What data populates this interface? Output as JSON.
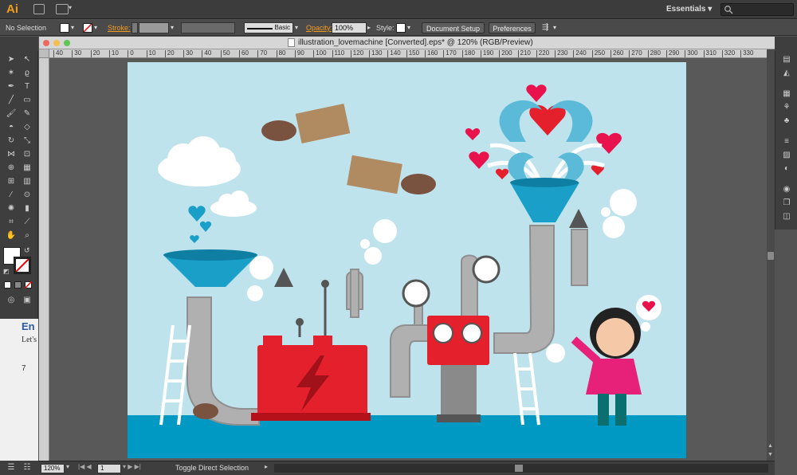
{
  "menubar": {
    "app_logo": "Ai",
    "workspace": "Essentials",
    "workspace_arrow": "▾",
    "search_icon": "magnifier"
  },
  "control": {
    "selection": "No Selection",
    "stroke_label": "Stroke:",
    "brush_label": "Basic",
    "opacity_label": "Opacity:",
    "opacity_value": "100%",
    "style_label": "Style:",
    "doc_setup": "Document Setup",
    "preferences": "Preferences"
  },
  "document": {
    "tab_title": "illustration_lovemachine [Converted].eps* @ 120% (RGB/Preview)"
  },
  "ruler": {
    "ticks": [
      "40",
      "30",
      "20",
      "10",
      "0",
      "10",
      "20",
      "30",
      "40",
      "50",
      "60",
      "70",
      "80",
      "90",
      "100",
      "110",
      "120",
      "130",
      "140",
      "150",
      "160",
      "170",
      "180",
      "190",
      "200",
      "210",
      "220",
      "230",
      "240",
      "250",
      "260",
      "270",
      "280",
      "290",
      "300",
      "310",
      "320",
      "330"
    ]
  },
  "status": {
    "zoom": "120%",
    "page": "1",
    "tool": "Toggle Direct Selection"
  },
  "background_doc": {
    "heading": "En",
    "line1": "Let's",
    "num": "7"
  },
  "colors": {
    "sky": "#bfe3ec",
    "floor": "#0099c4",
    "machine": "#e3202c",
    "pipe": "#b0b0b0",
    "heart": "#e8124d",
    "funnel": "#1a9fc8",
    "girl_shirt": "#e7207a"
  }
}
